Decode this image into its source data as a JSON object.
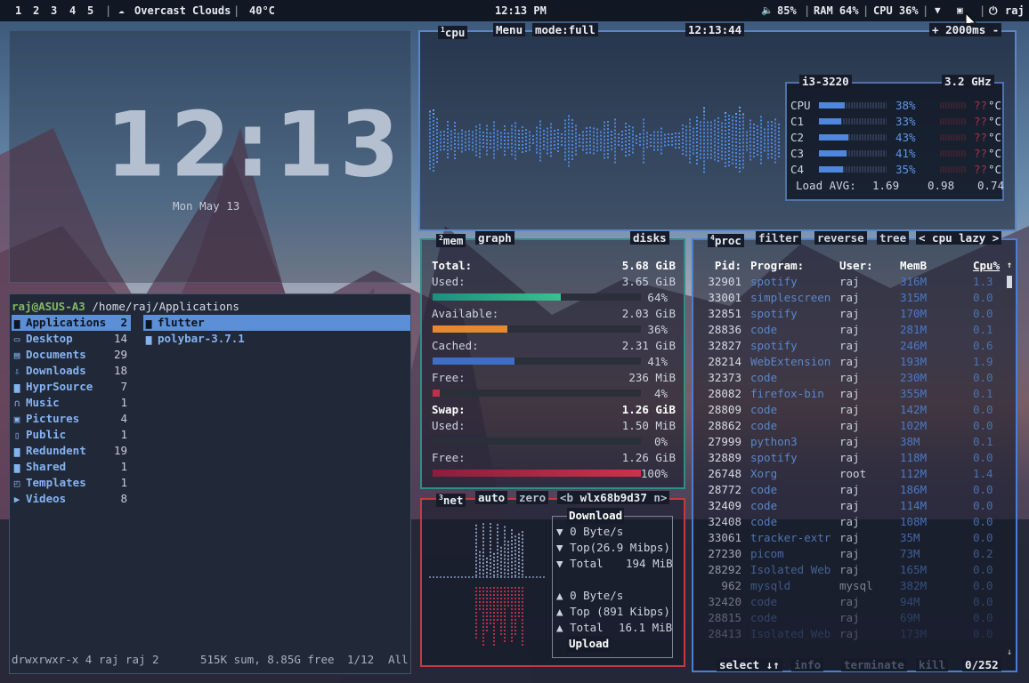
{
  "topbar": {
    "workspaces": [
      "1",
      "2",
      "3",
      "4",
      "5"
    ],
    "weather_icon": "cloud-icon",
    "weather": "Overcast Clouds",
    "temperature": "40°C",
    "clock": "12:13 PM",
    "volume": "85%",
    "ram": "RAM 64%",
    "cpu": "CPU 36%",
    "user": "raj"
  },
  "clock_widget": {
    "time": "12:13",
    "date": "Mon May 13"
  },
  "file_manager": {
    "prompt": "raj@ASUS-A3",
    "path": "/home/raj/Applications",
    "left": [
      {
        "icon": "folder-icon",
        "name": "Applications",
        "count": "2"
      },
      {
        "icon": "monitor-icon",
        "name": "Desktop",
        "count": "14"
      },
      {
        "icon": "document-icon",
        "name": "Documents",
        "count": "29"
      },
      {
        "icon": "download-icon",
        "name": "Downloads",
        "count": "18"
      },
      {
        "icon": "folder-icon",
        "name": "HyprSource",
        "count": "7"
      },
      {
        "icon": "headphones-icon",
        "name": "Music",
        "count": "1"
      },
      {
        "icon": "picture-icon",
        "name": "Pictures",
        "count": "4"
      },
      {
        "icon": "public-icon",
        "name": "Public",
        "count": "1"
      },
      {
        "icon": "folder-icon",
        "name": "Redundent",
        "count": "19"
      },
      {
        "icon": "folder-icon",
        "name": "Shared",
        "count": "1"
      },
      {
        "icon": "template-icon",
        "name": "Templates",
        "count": "1"
      },
      {
        "icon": "video-icon",
        "name": "Videos",
        "count": "8"
      }
    ],
    "right": [
      "flutter",
      "polybar-3.7.1"
    ],
    "status_perm": "drwxrwxr-x 4 raj raj 2",
    "status_sum": "515K sum, 8.85G free",
    "status_pos": "1/12",
    "status_all": "All"
  },
  "cpu": {
    "title": "cpu",
    "menu": "Menu",
    "mode": "mode:full",
    "time": "12:13:44",
    "interval": "2000ms",
    "model": "i3-3220",
    "freq": "3.2 GHz",
    "rows": [
      {
        "label": "CPU",
        "pct": "38%",
        "temp": "??",
        "unit": "°C",
        "level": 0.38
      },
      {
        "label": "C1",
        "pct": "33%",
        "temp": "??",
        "unit": "°C",
        "level": 0.33
      },
      {
        "label": "C2",
        "pct": "43%",
        "temp": "??",
        "unit": "°C",
        "level": 0.43
      },
      {
        "label": "C3",
        "pct": "41%",
        "temp": "??",
        "unit": "°C",
        "level": 0.41
      },
      {
        "label": "C4",
        "pct": "35%",
        "temp": "??",
        "unit": "°C",
        "level": 0.35
      }
    ],
    "load_label": "Load AVG:",
    "load": [
      "1.69",
      "0.98",
      "0.74"
    ]
  },
  "mem": {
    "title": "mem",
    "graph": "graph",
    "disks": "disks",
    "total_label": "Total:",
    "total": "5.68 GiB",
    "used_label": "Used:",
    "used": "3.65 GiB",
    "used_pct": "64%",
    "avail_label": "Available:",
    "avail": "2.03 GiB",
    "avail_pct": "36%",
    "cached_label": "Cached:",
    "cached": "2.31 GiB",
    "cached_pct": "41%",
    "free_label": "Free:",
    "free": "236 MiB",
    "free_pct": "4%",
    "swap_label": "Swap:",
    "swap": "1.26 GiB",
    "swap_used_label": "Used:",
    "swap_used": "1.50 MiB",
    "swap_used_pct": "0%",
    "swap_free_label": "Free:",
    "swap_free": "1.26 GiB",
    "swap_free_pct": "100%"
  },
  "net": {
    "title": "net",
    "auto": "auto",
    "zero": "zero",
    "iface_prev": "<b",
    "iface": "wlx68b9d37",
    "iface_next": "n>",
    "download": "Download",
    "dl_rate": "0 Byte/s",
    "dl_top": "Top(26.9 Mibps)",
    "dl_total_label": "Total",
    "dl_total": "194 MiB",
    "ul_rate": "0 Byte/s",
    "ul_top": "Top (891 Kibps)",
    "ul_total_label": "Total",
    "ul_total": "16.1 MiB",
    "upload": "Upload"
  },
  "proc": {
    "title": "proc",
    "filter": "filter",
    "reverse": "reverse",
    "tree": "tree",
    "sort": "< cpu lazy >",
    "headers": {
      "pid": "Pid:",
      "program": "Program:",
      "user": "User:",
      "mem": "MemB",
      "cpu": "Cpu%"
    },
    "rows": [
      {
        "pid": "32901",
        "program": "spotify",
        "user": "raj",
        "mem": "316M",
        "cpu": "1.3"
      },
      {
        "pid": "33001",
        "program": "simplescreen",
        "user": "raj",
        "mem": "315M",
        "cpu": "0.0"
      },
      {
        "pid": "32851",
        "program": "spotify",
        "user": "raj",
        "mem": "170M",
        "cpu": "0.0"
      },
      {
        "pid": "28836",
        "program": "code",
        "user": "raj",
        "mem": "281M",
        "cpu": "0.1"
      },
      {
        "pid": "32827",
        "program": "spotify",
        "user": "raj",
        "mem": "246M",
        "cpu": "0.6"
      },
      {
        "pid": "28214",
        "program": "WebExtension",
        "user": "raj",
        "mem": "193M",
        "cpu": "1.9"
      },
      {
        "pid": "32373",
        "program": "code",
        "user": "raj",
        "mem": "230M",
        "cpu": "0.0"
      },
      {
        "pid": "28082",
        "program": "firefox-bin",
        "user": "raj",
        "mem": "355M",
        "cpu": "0.1"
      },
      {
        "pid": "28809",
        "program": "code",
        "user": "raj",
        "mem": "142M",
        "cpu": "0.0"
      },
      {
        "pid": "28862",
        "program": "code",
        "user": "raj",
        "mem": "102M",
        "cpu": "0.0"
      },
      {
        "pid": "27999",
        "program": "python3",
        "user": "raj",
        "mem": "38M",
        "cpu": "0.1"
      },
      {
        "pid": "32889",
        "program": "spotify",
        "user": "raj",
        "mem": "118M",
        "cpu": "0.0"
      },
      {
        "pid": "26748",
        "program": "Xorg",
        "user": "root",
        "mem": "112M",
        "cpu": "1.4"
      },
      {
        "pid": "28772",
        "program": "code",
        "user": "raj",
        "mem": "186M",
        "cpu": "0.0"
      },
      {
        "pid": "32409",
        "program": "code",
        "user": "raj",
        "mem": "114M",
        "cpu": "0.0"
      },
      {
        "pid": "32408",
        "program": "code",
        "user": "raj",
        "mem": "108M",
        "cpu": "0.0"
      },
      {
        "pid": "33061",
        "program": "tracker-extr",
        "user": "raj",
        "mem": "35M",
        "cpu": "0.0"
      },
      {
        "pid": "27230",
        "program": "picom",
        "user": "raj",
        "mem": "73M",
        "cpu": "0.2"
      },
      {
        "pid": "28292",
        "program": "Isolated Web",
        "user": "raj",
        "mem": "165M",
        "cpu": "0.0"
      },
      {
        "pid": "962",
        "program": "mysqld",
        "user": "mysql",
        "mem": "382M",
        "cpu": "0.0"
      },
      {
        "pid": "32420",
        "program": "code",
        "user": "raj",
        "mem": "94M",
        "cpu": "0.0"
      },
      {
        "pid": "28815",
        "program": "code",
        "user": "raj",
        "mem": "69M",
        "cpu": "0.0"
      },
      {
        "pid": "28413",
        "program": "Isolated Web",
        "user": "raj",
        "mem": "173M",
        "cpu": "0.0"
      }
    ],
    "select": "select",
    "info": "info",
    "terminate": "terminate",
    "kill": "kill",
    "count": "0/252"
  }
}
